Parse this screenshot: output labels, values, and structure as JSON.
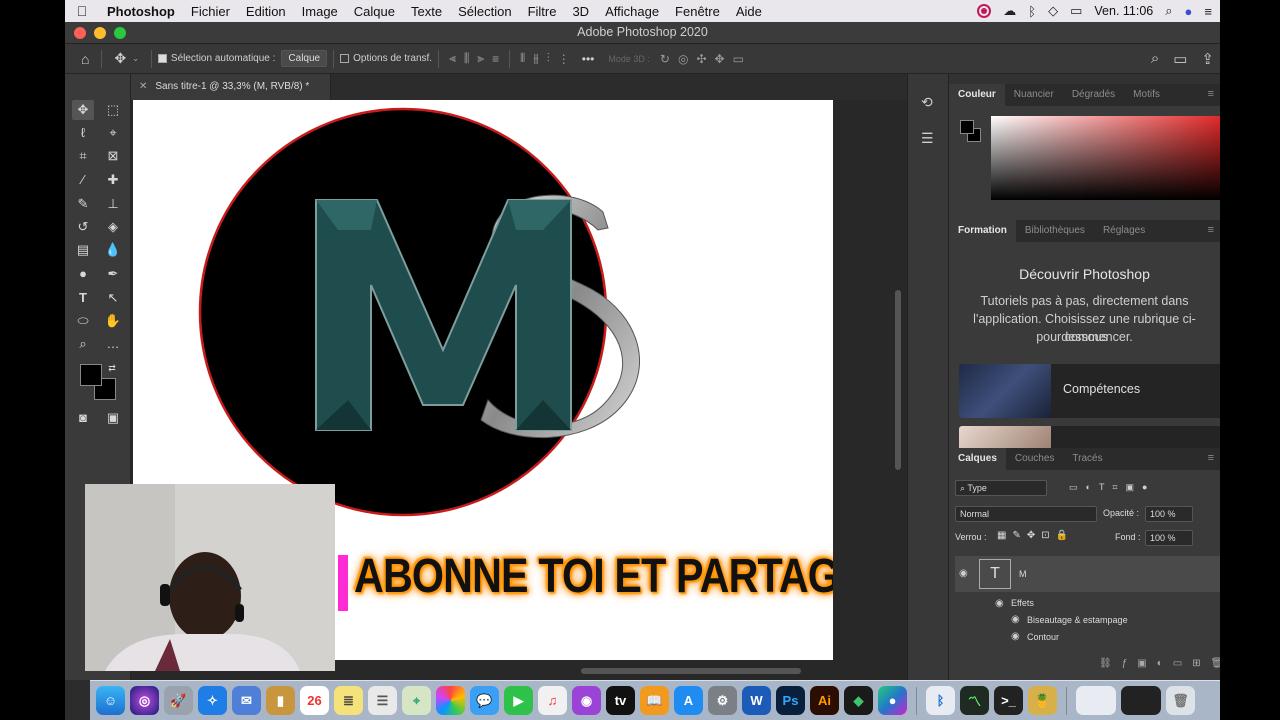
{
  "menubar": {
    "app": "Photoshop",
    "items": [
      "Fichier",
      "Edition",
      "Image",
      "Calque",
      "Texte",
      "Sélection",
      "Filtre",
      "3D",
      "Affichage",
      "Fenêtre",
      "Aide"
    ],
    "clock": "Ven. 11:06"
  },
  "window": {
    "title": "Adobe Photoshop 2020"
  },
  "options": {
    "auto_select_label": "Sélection automatique :",
    "auto_select_target": "Calque",
    "transform_label": "Options de transf.",
    "more": "•••",
    "mode3d": "Mode 3D :"
  },
  "document": {
    "tab_title": "Sans titre-1 @ 33,3% (M, RVB/8) *",
    "logo_text": "MS",
    "banner_text": "ABONNE TOI ET PARTAGE"
  },
  "panels": {
    "color": {
      "tabs": [
        "Couleur",
        "Nuancier",
        "Dégradés",
        "Motifs"
      ]
    },
    "learn": {
      "tabs": [
        "Formation",
        "Bibliothèques",
        "Réglages"
      ],
      "heading": "Découvrir Photoshop",
      "line1": "Tutoriels pas à pas, directement dans",
      "line2": "l'application. Choisissez une rubrique ci-dessous",
      "line3": "pour commencer.",
      "card1": "Compétences"
    },
    "layers": {
      "tabs": [
        "Calques",
        "Couches",
        "Tracés"
      ],
      "filter": "Type",
      "blend_mode": "Normal",
      "opacity_label": "Opacité :",
      "opacity_value": "100 %",
      "lock_label": "Verrou :",
      "fill_label": "Fond :",
      "fill_value": "100 %",
      "layer_name": "M",
      "effects_label": "Effets",
      "effect1": "Biseautage & estampage",
      "effect2": "Contour",
      "fx": "fx"
    }
  },
  "colors": {
    "menubar_bg": "#e9e7ec",
    "ps_panel": "#3a3a3a",
    "logo_teal": "#1f4c4c",
    "banner_glow": "#ff9a00",
    "accent_pink": "#ff2bd6"
  }
}
